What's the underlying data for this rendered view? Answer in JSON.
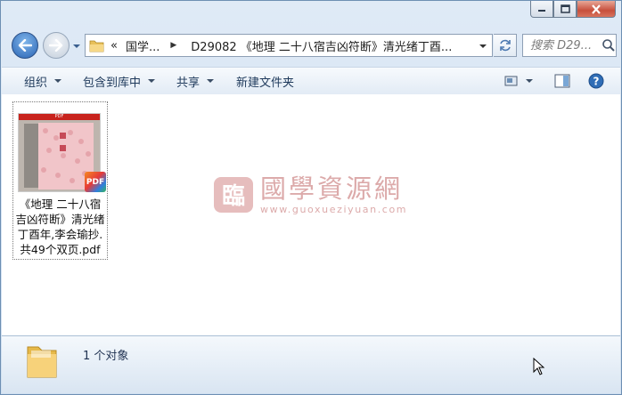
{
  "breadcrumb": {
    "overflow": "«",
    "root": "国学...",
    "current": "D29082 《地理 二十八宿吉凶符断》清光绪丁酉..."
  },
  "search": {
    "placeholder": "搜索 D29..."
  },
  "toolbar": {
    "organize": "组织",
    "include_in_library": "包含到库中",
    "share": "共享",
    "new_folder": "新建文件夹"
  },
  "file": {
    "name": "《地理 二十八宿吉凶符断》清光绪丁酉年,李会瑜抄.共49个双页.pdf",
    "name_lines": [
      "《地理 二十八宿",
      "吉凶符断》清光绪",
      "丁酉年,李会瑜抄.",
      "共49个双页.pdf"
    ],
    "thumb_label": "PDF",
    "badge": "PDF"
  },
  "watermark": {
    "text": "國學資源網",
    "url": "www.guoxueziyuan.com"
  },
  "status": {
    "count": "1 个对象"
  },
  "colors": {
    "accent": "#2a64b4",
    "pdf_red": "#e13a2a",
    "watermark": "#d8a3a3"
  }
}
